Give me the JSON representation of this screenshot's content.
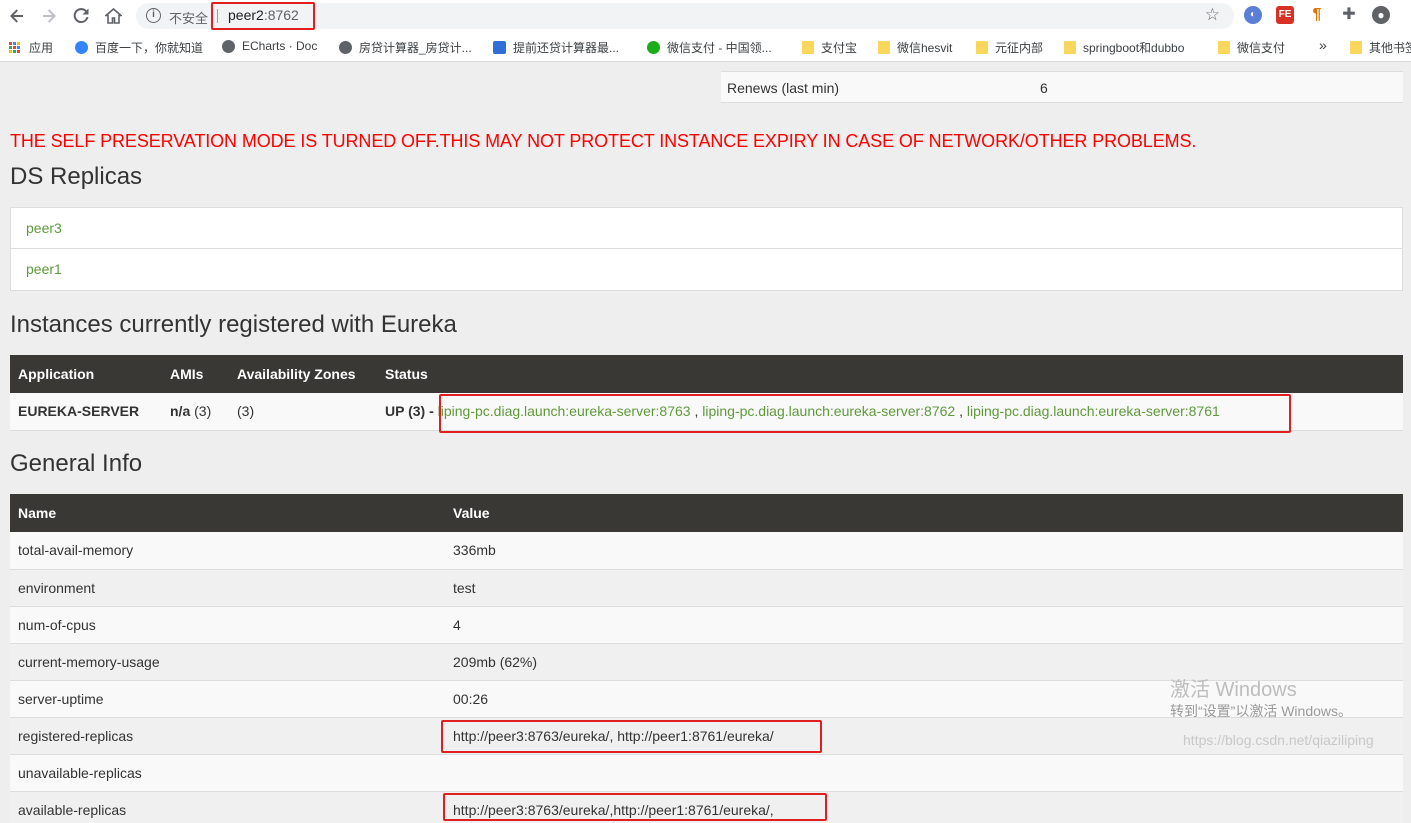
{
  "browser": {
    "insecure_label": "不安全",
    "url_host": "peer2",
    "url_port": ":8762",
    "bookmarks": [
      {
        "label": "应用",
        "icon": "apps-grid-icon"
      },
      {
        "label": "百度一下，你就知道",
        "icon": "baidu-icon"
      },
      {
        "label": "ECharts · Doc",
        "icon": "globe-icon"
      },
      {
        "label": "房贷计算器_房贷计...",
        "icon": "globe-icon"
      },
      {
        "label": "提前还贷计算器最...",
        "icon": "rong-icon"
      },
      {
        "label": "微信支付 - 中国领...",
        "icon": "wechat-icon"
      },
      {
        "label": "支付宝",
        "icon": "folder-icon"
      },
      {
        "label": "微信hesvit",
        "icon": "folder-icon"
      },
      {
        "label": "元征内部",
        "icon": "folder-icon"
      },
      {
        "label": "springboot和dubbo",
        "icon": "folder-icon"
      },
      {
        "label": "微信支付",
        "icon": "folder-icon"
      }
    ],
    "overflow_label": "»",
    "other_bookmarks": "其他书签"
  },
  "renews": {
    "label": "Renews (last min)",
    "value": "6"
  },
  "warning": "THE SELF PRESERVATION MODE IS TURNED OFF.THIS MAY NOT PROTECT INSTANCE EXPIRY IN CASE OF NETWORK/OTHER PROBLEMS.",
  "ds_replicas": {
    "title": "DS Replicas",
    "items": [
      "peer3",
      "peer1"
    ]
  },
  "instances": {
    "title": "Instances currently registered with Eureka",
    "headers": [
      "Application",
      "AMIs",
      "Availability Zones",
      "Status"
    ],
    "row": {
      "application": "EUREKA-SERVER",
      "amis_bold": "n/a",
      "amis_count": "(3)",
      "zones": "(3)",
      "status_prefix": "UP (3) - ",
      "links": [
        "liping-pc.diag.launch:eureka-server:8763",
        "liping-pc.diag.launch:eureka-server:8762",
        "liping-pc.diag.launch:eureka-server:8761"
      ],
      "link_separator": " , "
    }
  },
  "general_info": {
    "title": "General Info",
    "headers": [
      "Name",
      "Value"
    ],
    "rows": [
      {
        "name": "total-avail-memory",
        "value": "336mb"
      },
      {
        "name": "environment",
        "value": "test"
      },
      {
        "name": "num-of-cpus",
        "value": "4"
      },
      {
        "name": "current-memory-usage",
        "value": "209mb (62%)"
      },
      {
        "name": "server-uptime",
        "value": "00:26"
      },
      {
        "name": "registered-replicas",
        "value": "http://peer3:8763/eureka/, http://peer1:8761/eureka/"
      },
      {
        "name": "unavailable-replicas",
        "value": ""
      },
      {
        "name": "available-replicas",
        "value": "http://peer3:8763/eureka/,http://peer1:8761/eureka/,"
      }
    ]
  },
  "watermark": {
    "activate": "激活 Windows",
    "activate_hint": "转到“设置”以激活 Windows。",
    "blog": "https://blog.csdn.net/qiaziliping"
  }
}
